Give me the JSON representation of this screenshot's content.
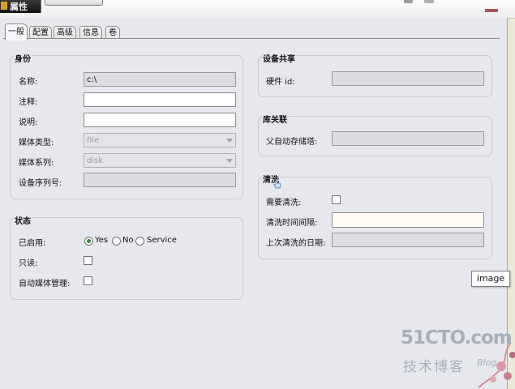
{
  "window": {
    "title": "属性"
  },
  "tabs": [
    {
      "label": "一般",
      "active": true
    },
    {
      "label": "配置"
    },
    {
      "label": "高级"
    },
    {
      "label": "信息"
    },
    {
      "label": "卷"
    }
  ],
  "identity": {
    "title": "身份",
    "name_label": "名称:",
    "name_value": "c:\\",
    "comment_label": "注释:",
    "comment_value": "",
    "description_label": "说明:",
    "description_value": "",
    "media_type_label": "媒体类型:",
    "media_type_value": "file",
    "media_family_label": "媒体系列:",
    "media_family_value": "disk",
    "serial_label": "设备序列号:",
    "serial_value": ""
  },
  "status": {
    "title": "状态",
    "enabled_label": "已启用:",
    "enabled_options": [
      "Yes",
      "No",
      "Service"
    ],
    "enabled_selected": "Yes",
    "readonly_label": "只读:",
    "readonly_checked": false,
    "auto_media_label": "自动媒体管理:",
    "auto_media_checked": false
  },
  "device_sharing": {
    "title": "设备共享",
    "hardware_id_label": "硬件 id:",
    "hardware_id_value": ""
  },
  "library_association": {
    "title": "库关联",
    "parent_autoloader_label": "父自动存储塔:",
    "parent_autoloader_value": ""
  },
  "cleaning": {
    "title": "清洗",
    "needs_cleaning_label": "需要清洗:",
    "needs_cleaning_checked": false,
    "interval_label": "清洗时间间隔:",
    "interval_value": "",
    "last_cleaned_label": "上次清洗的日期:",
    "last_cleaned_value": ""
  },
  "tooltip": {
    "text": "image"
  },
  "watermark": {
    "brand": "51CTO.com",
    "sub": "技术博客",
    "blog": "Blog"
  }
}
